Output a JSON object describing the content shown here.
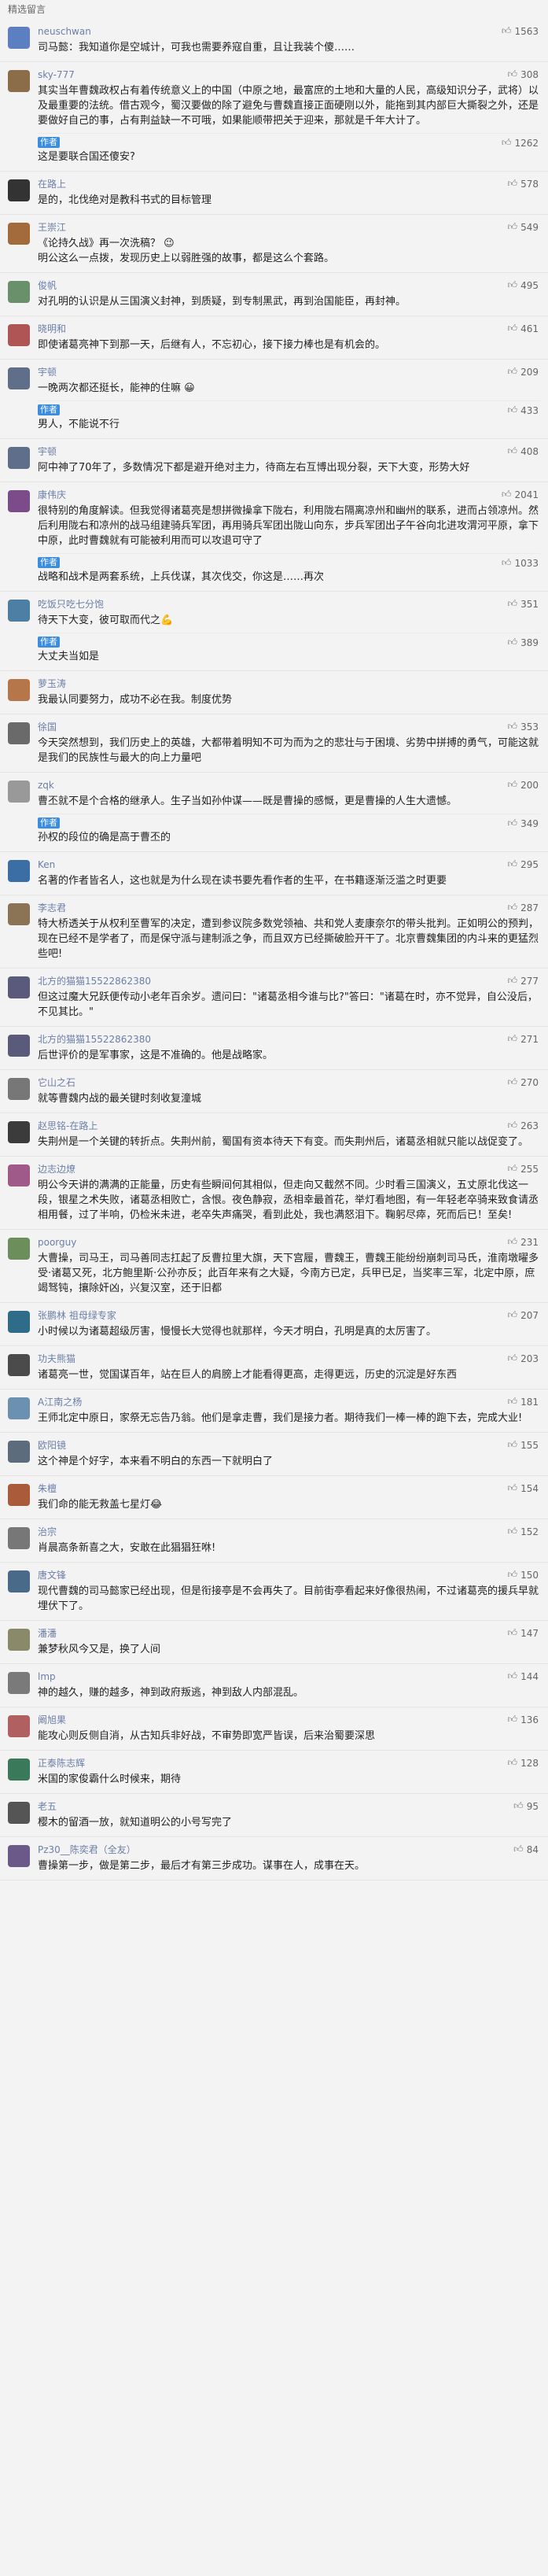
{
  "page": {
    "title": "精选留言"
  },
  "comments": [
    {
      "user": "neuschwan",
      "likes": "1563",
      "color": "#5b7fc0",
      "text": "司马懿：我知道你是空城计，可我也需要养寇自重，且让我装个傻……"
    },
    {
      "user": "sky-777",
      "likes": "308",
      "color": "#8b6d4a",
      "text": "其实当年曹魏政权占有着传统意义上的中国（中原之地，最富庶的土地和大量的人民，高级知识分子，武将）以及最重要的法统。借古观今，蜀汉要做的除了避免与曹魏直接正面硬刚以外，能拖到其内部巨大撕裂之外，还是要做好自己的事，占有荆益缺一不可哦，如果能顺带把关于迎来，那就是千年大计了。",
      "reply": {
        "user": "作者",
        "likes": "1262",
        "text": "这是要联合国还傻安?"
      }
    },
    {
      "user": "在路上",
      "likes": "578",
      "color": "#333",
      "text": "是的，北伐绝对是教科书式的目标管理"
    },
    {
      "user": "王崇江",
      "likes": "549",
      "color": "#a36a3b",
      "text": "《论持久战》再一次洗稿？ 😉\n明公这么一点拨，发现历史上以弱胜强的故事，都是这么个套路。"
    },
    {
      "user": "俊帆",
      "likes": "495",
      "color": "#6a8f6b",
      "text": "对孔明的认识是从三国演义封神，到质疑，到专制黑武，再到治国能臣，再封神。"
    },
    {
      "user": "晓明和",
      "likes": "461",
      "color": "#b05555",
      "text": "即使诸葛亮神下到那一天，后继有人，不忘初心，接下接力棒也是有机会的。"
    },
    {
      "user": "宇顿",
      "likes": "209",
      "color": "#5f6f8a",
      "text": "一晚两次都还挺长，能神的住嘛 😀",
      "reply": {
        "user": "作者",
        "likes": "433",
        "text": "男人，不能说不行"
      }
    },
    {
      "user": "宇顿",
      "likes": "408",
      "color": "#5f6f8a",
      "text": "阿中神了70年了，多数情况下都是避开绝对主力，待商左右互博出现分裂，天下大变，形势大好"
    },
    {
      "user": "康伟庆",
      "likes": "2041",
      "color": "#7c4b8a",
      "text": "很特别的角度解读。但我觉得诸葛亮是想拼微操拿下陇右，利用陇右隔离凉州和幽州的联系，进而占领凉州。然后利用陇右和凉州的战马组建骑兵军团，再用骑兵军团出陇山向东，步兵军团出子午谷向北进攻渭河平原，拿下中原，此时曹魏就有可能被利用而可以攻退可守了",
      "reply": {
        "user": "作者",
        "likes": "1033",
        "text": "战略和战术是两套系统，上兵伐谋，其次伐交，你这是……再次"
      }
    },
    {
      "user": "吃饭只吃七分饱",
      "likes": "351",
      "color": "#4c7fa3",
      "text": "待天下大变，彼可取而代之💪",
      "reply": {
        "user": "作者",
        "likes": "389",
        "text": "大丈夫当如是"
      }
    },
    {
      "user": "萝玉涛",
      "likes": "",
      "color": "#b5764a",
      "text": "我最认同要努力，成功不必在我。制度优势"
    },
    {
      "user": "徐国",
      "likes": "353",
      "color": "#6a6a6a",
      "text": "今天突然想到，我们历史上的英雄，大都带着明知不可为而为之的悲壮与于困境、劣势中拼搏的勇气，可能这就是我们的民族性与最大的向上力量吧"
    },
    {
      "user": "zqk",
      "likes": "200",
      "color": "#999",
      "text": "曹丕就不是个合格的继承人。生子当如孙仲谋——既是曹操的感慨，更是曹操的人生大遗憾。",
      "reply": {
        "user": "作者",
        "likes": "349",
        "text": "孙权的段位的确是高于曹丕的"
      }
    },
    {
      "user": "Ken",
      "likes": "295",
      "color": "#3a6ea5",
      "text": "名著的作者皆名人，这也就是为什么现在读书要先看作者的生平，在书籍逐渐泛滥之时更要"
    },
    {
      "user": "李志君",
      "likes": "287",
      "color": "#8b7355",
      "text": "特大桥透关于从权利至曹军的决定，遭到参议院多数党领袖、共和党人麦康奈尔的带头批判。正如明公的预判，现在已经不是学者了，而是保守派与建制派之争，而且双方已经撕破脸开干了。北京曹魏集团的内斗来的更猛烈些吧!"
    },
    {
      "user": "北方的猫猫15522862380",
      "likes": "277",
      "color": "#5a5a7a",
      "text": "但这过魔大兄跃便传动小老年百余岁。遗问曰：\"诸葛丞相今谁与比?\"答曰：\"诸葛在时，亦不觉异，自公没后，不见其比。\""
    },
    {
      "user": "北方的猫猫15522862380",
      "likes": "271",
      "color": "#5a5a7a",
      "text": "后世评价的是军事家，这是不准确的。他是战略家。"
    },
    {
      "user": "它山之石",
      "likes": "270",
      "color": "#777",
      "text": "就等曹魏内战的最关键时刻收复潼城"
    },
    {
      "user": "赵思铭-在路上",
      "likes": "263",
      "color": "#3b3b3b",
      "text": "失荆州是一个关键的转折点。失荆州前，蜀国有资本待天下有变。而失荆州后，诸葛丞相就只能以战促变了。"
    },
    {
      "user": "边志边燎",
      "likes": "255",
      "color": "#a05a8a",
      "text": "明公今天讲的满满的正能量，历史有些瞬间何其相似，但走向又截然不同。少时看三国演义，五丈原北伐这一段，银星之术失败，诸葛丞相败亡，含恨。夜色静寂，丞相幸最首花，举灯看地图，有一年轻老卒骑来致食请丞相用餐，过了半响，仍检米未进，老卒失声痛哭，看到此处，我也满怒泪下。鞠躬尽瘁，死而后已！至矣!"
    },
    {
      "user": "poorguy",
      "likes": "231",
      "color": "#6b8e5a",
      "text": "大曹操，司马王，司马善同志扛起了反曹拉里大旗，天下宫履，曹魏王，曹魏王能纷纷崩刺司马氏，淮南墩曜多受·诸葛又死，北方鲍里斯·公孙亦反；此百年来有之大疑，今南方已定，兵甲已足，当奖率三军，北定中原，庶竭驽钝，攘除奸凶，兴复汉室，还于旧都"
    },
    {
      "user": "张鹏林 祖母绿专家",
      "likes": "207",
      "color": "#2e6c8a",
      "text": "小时候以为诸葛超级厉害，慢慢长大觉得也就那样，今天才明白，孔明是真的太厉害了。"
    },
    {
      "user": "功夫熊猫",
      "likes": "203",
      "color": "#4b4b4b",
      "text": "诸葛亮一世，觉国谋百年，站在巨人的肩膀上才能看得更高，走得更远，历史的沉淀是好东西"
    },
    {
      "user": "A江南之杨",
      "likes": "181",
      "color": "#6c90b0",
      "text": "王师北定中原日，家祭无忘告乃翁。他们是拿走曹，我们是接力者。期待我们一棒一棒的跑下去，完成大业!"
    },
    {
      "user": "欧阳镜",
      "likes": "155",
      "color": "#5c6c7c",
      "text": "这个神是个好字，本来看不明白的东西一下就明白了"
    },
    {
      "user": "朱檀",
      "likes": "154",
      "color": "#aa5b3a",
      "text": "我们命的能无救盖七星灯😂"
    },
    {
      "user": "治宗",
      "likes": "152",
      "color": "#777",
      "text": "肖晨高条新喜之大，安敢在此猖猖狂咻!"
    },
    {
      "user": "唐文锋",
      "likes": "150",
      "color": "#4a6a8a",
      "text": "现代曹魏的司马懿家已经出现，但是衔接亭是不会再失了。目前街亭看起来好像很热闹，不过诸葛亮的援兵早就埋伏下了。"
    },
    {
      "user": "潘潘",
      "likes": "147",
      "color": "#8a8a6a",
      "text": "兼梦秋风今又是，换了人间"
    },
    {
      "user": "lmp",
      "likes": "144",
      "color": "#7a7a7a",
      "text": "神的越久，赚的越多，神到政府叛逃，神到敌人内部混乱。"
    },
    {
      "user": "阚旭果",
      "likes": "136",
      "color": "#b06060",
      "text": "能攻心则反侧自消，从古知兵非好战，不审势即宽严皆误，后来治蜀要深思"
    },
    {
      "user": "正泰陈志辉",
      "likes": "128",
      "color": "#3a7a5a",
      "text": "米国的家俊霸什么时候来，期待"
    },
    {
      "user": "老五",
      "likes": "95",
      "color": "#555",
      "text": "樱木的留酒一放，就知道明公的小号写完了"
    },
    {
      "user": "Pz30__陈奕君（全友）",
      "likes": "84",
      "color": "#6a5a8a",
      "text": "曹操第一步，做是第二步，最后才有第三步成功。谋事在人，成事在天。"
    }
  ]
}
